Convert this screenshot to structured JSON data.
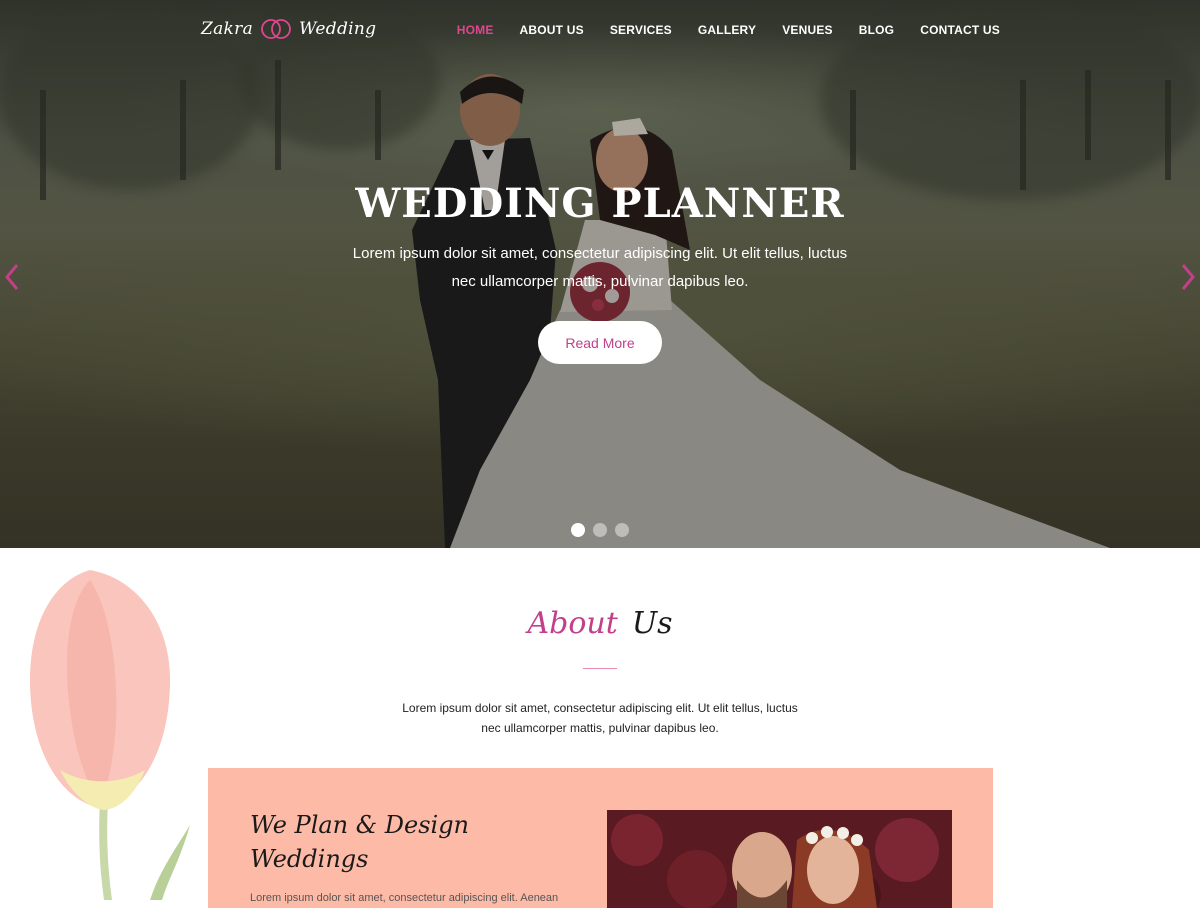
{
  "header": {
    "logo": {
      "word1": "Zakra",
      "word2": "Wedding",
      "icon": "rings-icon"
    },
    "nav": [
      {
        "label": "HOME",
        "active": true
      },
      {
        "label": "ABOUT US",
        "active": false
      },
      {
        "label": "SERVICES",
        "active": false
      },
      {
        "label": "GALLERY",
        "active": false
      },
      {
        "label": "VENUES",
        "active": false
      },
      {
        "label": "BLOG",
        "active": false
      },
      {
        "label": "CONTACT US",
        "active": false
      }
    ]
  },
  "hero": {
    "title": "WEDDING PLANNER",
    "description": "Lorem ipsum dolor sit amet, consectetur adipiscing elit. Ut elit tellus, luctus nec ullamcorper mattis, pulvinar dapibus leo.",
    "button_label": "Read More",
    "prev_icon": "chevron-left-icon",
    "next_icon": "chevron-right-icon",
    "slides_total": 3,
    "active_slide": 1
  },
  "about": {
    "heading_word1": "About",
    "heading_word2": "Us",
    "description": "Lorem ipsum dolor sit amet, consectetur adipiscing elit. Ut elit tellus, luctus nec ullamcorper mattis, pulvinar dapibus leo.",
    "panel_heading": "We Plan & Design Weddings",
    "panel_text": "Lorem ipsum dolor sit amet, consectetur adipiscing elit. Aenean"
  },
  "colors": {
    "accent": "#c2408a",
    "nav_active": "#e0468e",
    "panel_bg": "#fdbba7",
    "divider": "#e58bb2"
  }
}
